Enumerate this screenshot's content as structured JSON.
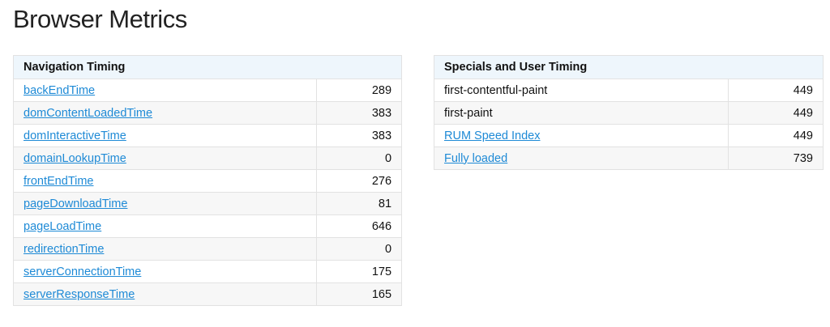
{
  "page": {
    "title": "Browser Metrics"
  },
  "navigation_timing": {
    "header": "Navigation Timing",
    "rows": [
      {
        "name": "backEndTime",
        "value": "289"
      },
      {
        "name": "domContentLoadedTime",
        "value": "383"
      },
      {
        "name": "domInteractiveTime",
        "value": "383"
      },
      {
        "name": "domainLookupTime",
        "value": "0"
      },
      {
        "name": "frontEndTime",
        "value": "276"
      },
      {
        "name": "pageDownloadTime",
        "value": "81"
      },
      {
        "name": "pageLoadTime",
        "value": "646"
      },
      {
        "name": "redirectionTime",
        "value": "0"
      },
      {
        "name": "serverConnectionTime",
        "value": "175"
      },
      {
        "name": "serverResponseTime",
        "value": "165"
      }
    ]
  },
  "specials_user_timing": {
    "header": "Specials and User Timing",
    "rows": [
      {
        "name": "first-contentful-paint",
        "value": "449"
      },
      {
        "name": "first-paint",
        "value": "449"
      },
      {
        "name": "RUM Speed Index",
        "value": "449"
      },
      {
        "name": "Fully loaded",
        "value": "739"
      }
    ]
  },
  "colors": {
    "link": "#1e8ad6",
    "header_bg": "#eef6fc",
    "stripe_bg": "#f7f7f7",
    "border": "#e2e2e2"
  }
}
